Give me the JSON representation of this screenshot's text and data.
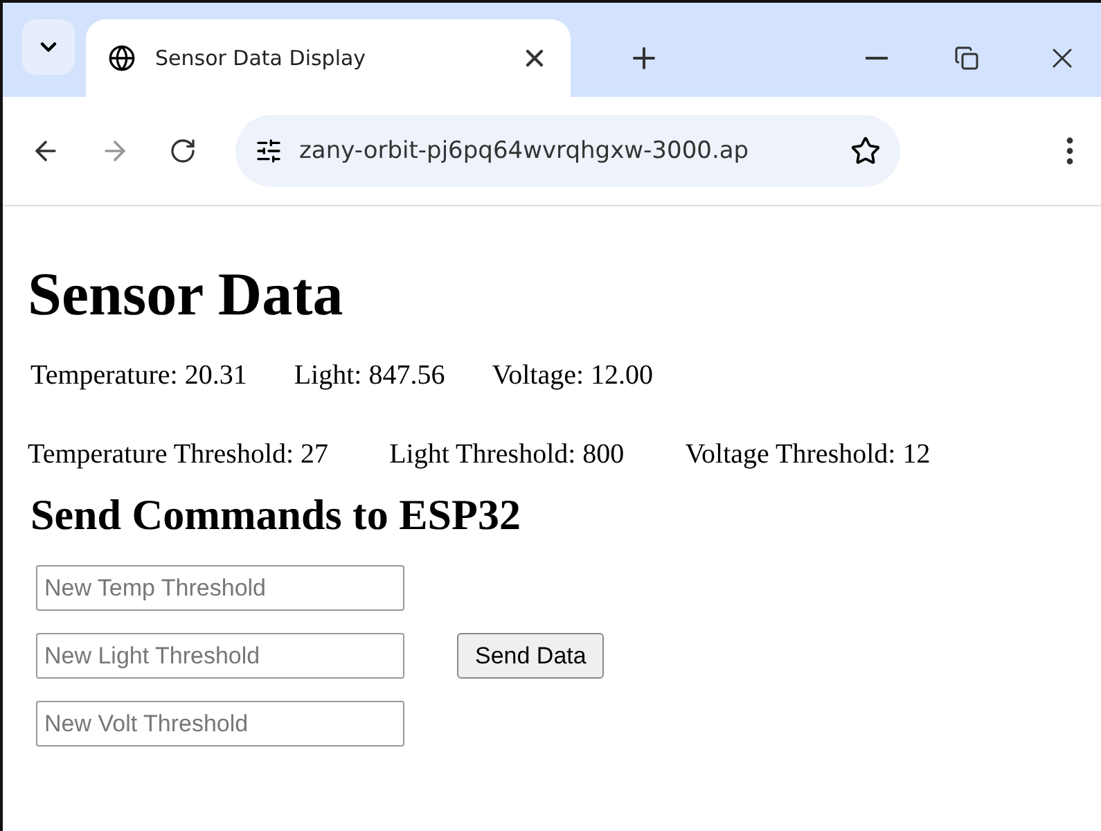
{
  "browser": {
    "tab_title": "Sensor Data Display",
    "address": "zany-orbit-pj6pq64wvrqhgxw-3000.ap"
  },
  "page": {
    "title": "Sensor Data",
    "readings": [
      "Temperature: 20.31",
      "Light: 847.56",
      "Voltage: 12.00"
    ],
    "thresholds": [
      "Temperature Threshold: 27",
      "Light Threshold: 800",
      "Voltage Threshold: 12"
    ],
    "commands_title": "Send Commands to ESP32",
    "fields": [
      {
        "placeholder": "New Temp Threshold"
      },
      {
        "placeholder": "New Light Threshold"
      },
      {
        "placeholder": "New Volt Threshold"
      }
    ],
    "button": "Send Data"
  }
}
